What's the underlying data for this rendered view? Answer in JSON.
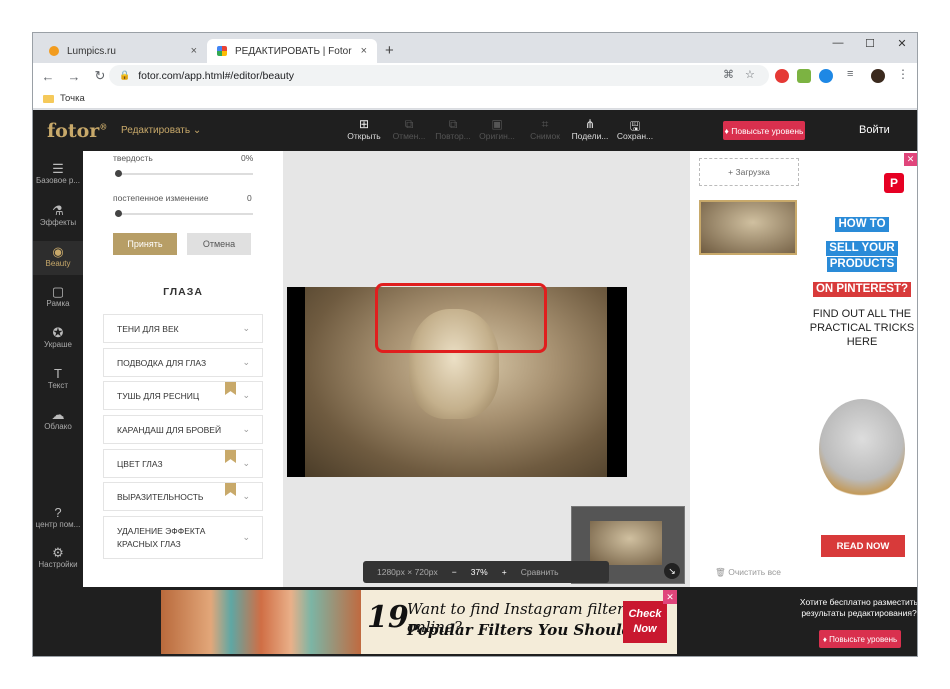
{
  "browser": {
    "tabs": [
      {
        "title": "Lumpics.ru",
        "close": "×",
        "color": "#f29c1f"
      },
      {
        "title": "РЕДАКТИРОВАТЬ | Fotor",
        "close": "×",
        "color": "#34a853"
      }
    ],
    "new_tab": "+",
    "window_controls": [
      "—",
      "☐",
      "✕"
    ],
    "url": "fotor.com/app.html#/editor/beauty",
    "bookmark": "Точка"
  },
  "app": {
    "logo": "fotor",
    "logo_mark": "®",
    "edit_menu": "Редактировать",
    "toolbar": [
      {
        "label": "Открыть",
        "icon": "open-icon",
        "enabled": true
      },
      {
        "label": "Отмен...",
        "icon": "undo-icon",
        "enabled": false
      },
      {
        "label": "Повтор...",
        "icon": "redo-icon",
        "enabled": false
      },
      {
        "label": "Оригин...",
        "icon": "original-icon",
        "enabled": false
      },
      {
        "label": "Снимок",
        "icon": "snapshot-icon",
        "enabled": false
      },
      {
        "label": "Подели...",
        "icon": "share-icon",
        "enabled": true
      },
      {
        "label": "Сохран...",
        "icon": "save-icon",
        "enabled": true
      }
    ],
    "upgrade": "Повысьте уровень",
    "login": "Войти",
    "rail": [
      {
        "label": "Базовое р...",
        "icon": "adjust-icon"
      },
      {
        "label": "Эффекты",
        "icon": "effects-icon"
      },
      {
        "label": "Beauty",
        "icon": "beauty-eye-icon",
        "active": true
      },
      {
        "label": "Рамка",
        "icon": "frame-icon"
      },
      {
        "label": "Украше",
        "icon": "stickers-icon"
      },
      {
        "label": "Текст",
        "icon": "text-icon"
      },
      {
        "label": "Облако",
        "icon": "cloud-icon"
      },
      {
        "label": "центр пом...",
        "icon": "help-icon"
      },
      {
        "label": "Настройки",
        "icon": "settings-icon"
      }
    ]
  },
  "panel": {
    "hardness_label": "твердость",
    "hardness_value": "0%",
    "gradual_label": "постепенное изменение",
    "gradual_value": "0",
    "apply": "Принять",
    "cancel": "Отмена",
    "section": "ГЛАЗА",
    "items": [
      {
        "label": "ТЕНИ ДЛЯ ВЕК",
        "premium": false
      },
      {
        "label": "ПОДВОДКА ДЛЯ ГЛАЗ",
        "premium": false
      },
      {
        "label": "ТУШЬ ДЛЯ РЕСНИЦ",
        "premium": true
      },
      {
        "label": "КАРАНДАШ ДЛЯ БРОВЕЙ",
        "premium": false
      },
      {
        "label": "ЦВЕТ ГЛАЗ",
        "premium": true
      },
      {
        "label": "ВЫРАЗИТЕЛЬНОСТЬ",
        "premium": true
      },
      {
        "label": "УДАЛЕНИЕ ЭФФЕКТА КРАСНЫХ ГЛАЗ",
        "premium": false
      }
    ]
  },
  "canvas": {
    "dimensions": "1280px × 720px",
    "zoom_out": "−",
    "zoom": "37%",
    "zoom_in": "+",
    "compare": "Сравнить",
    "highlight_color": "#e01e1e"
  },
  "right_panel": {
    "upload": "+ Загрузка",
    "clear_all": "Очистить все"
  },
  "ad_right": {
    "close": "✕",
    "pin": "P",
    "line1": "HOW TO",
    "line2": "SELL YOUR",
    "line3": "PRODUCTS",
    "line4": "ON PINTEREST?",
    "tip": "FIND OUT ALL THE PRACTICAL TRICKS HERE",
    "cta": "READ NOW"
  },
  "ad_bottom": {
    "number": "19",
    "line1": "Want to find Instagram filters online?",
    "line2": "Popular Filters You Should Try",
    "cta": "Check Now",
    "close": "✕"
  },
  "upsell": {
    "text": "Хотите бесплатно разместить результаты редактирования?",
    "button": "Повысьте уровень"
  }
}
